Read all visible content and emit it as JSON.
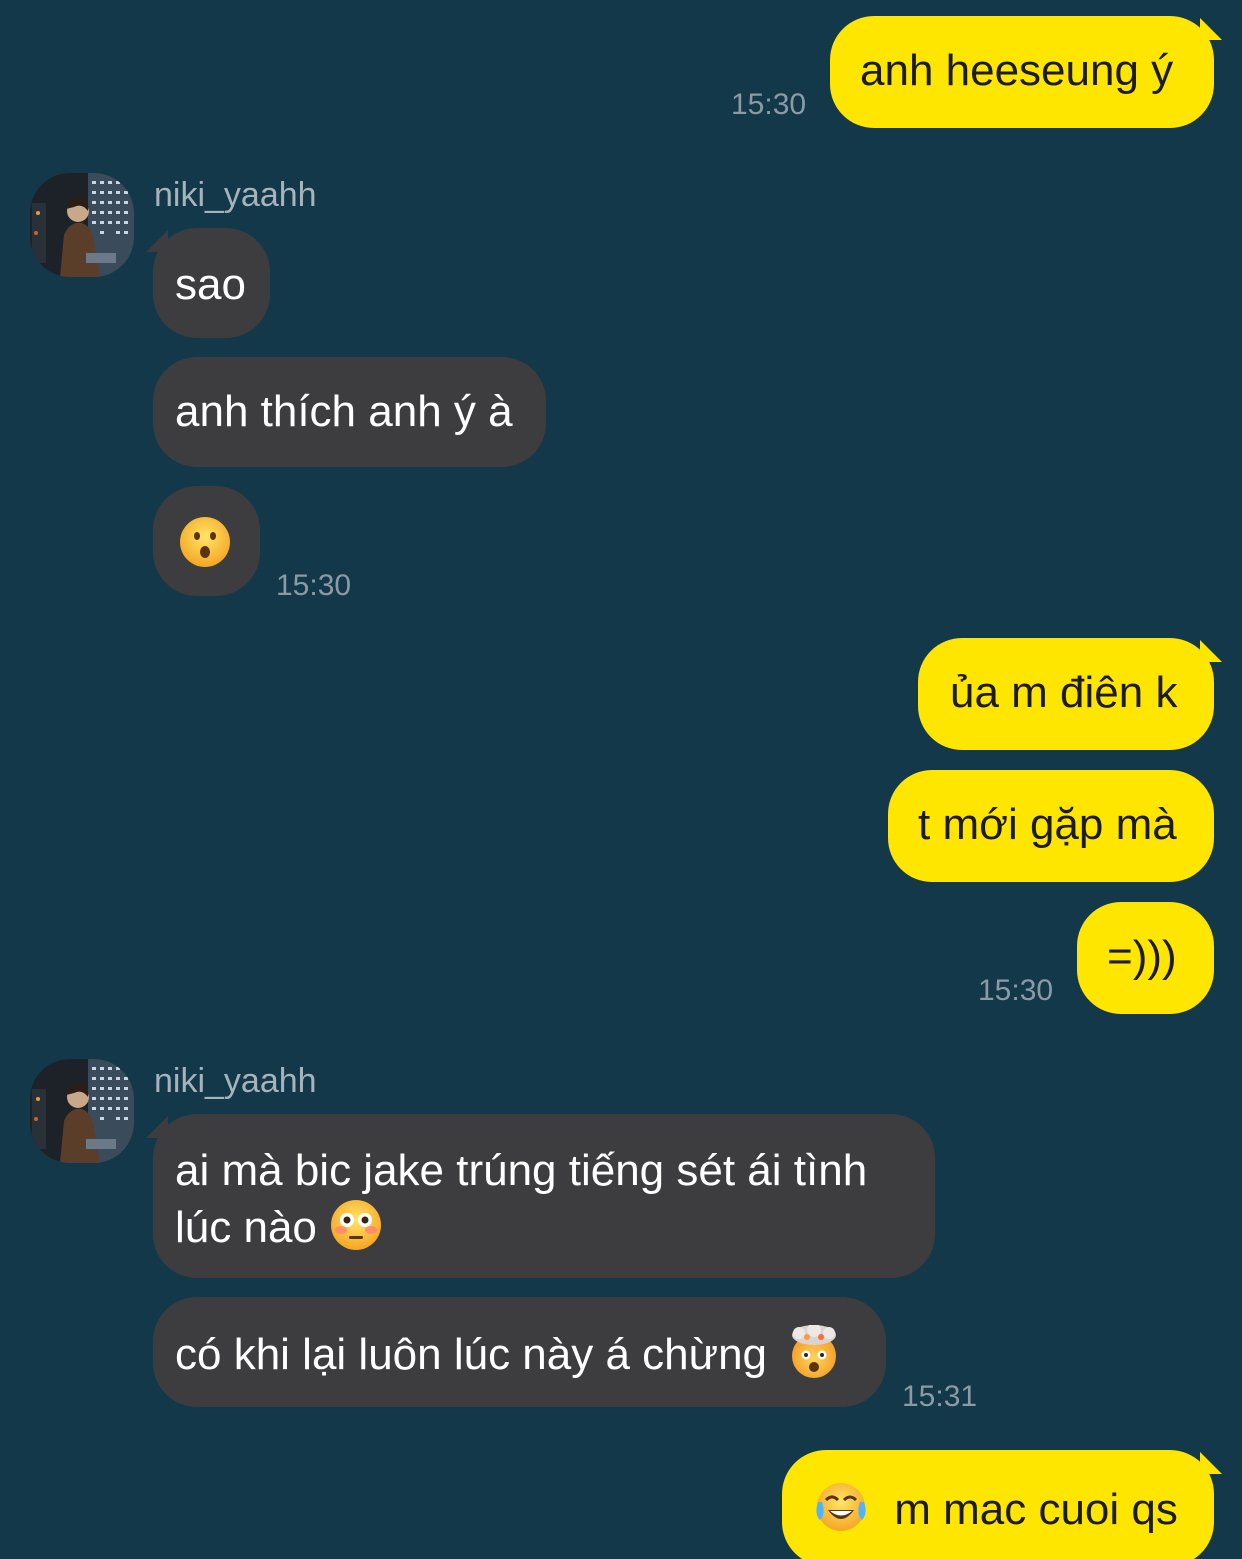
{
  "app": {
    "background_color": "#13384a",
    "outgoing_bubble_color": "#ffe600",
    "incoming_bubble_color": "#3d3d3f"
  },
  "messages": {
    "m1": {
      "text": "anh heeseung ý",
      "time": "15:30"
    },
    "sender1": {
      "name": "niki_yaahh"
    },
    "m2": {
      "text": "sao"
    },
    "m3": {
      "text": "anh thích anh ý à"
    },
    "m4": {
      "emoji": "hushed-face",
      "time": "15:30"
    },
    "m5": {
      "text": "ủa m điên k"
    },
    "m6": {
      "text": "t mới gặp mà"
    },
    "m7": {
      "text": "=)))",
      "time": "15:30"
    },
    "sender2": {
      "name": "niki_yaahh"
    },
    "m8": {
      "line1": "ai mà bic jake trúng tiếng sét ái tình",
      "line2": "lúc nào",
      "emoji": "flushed-face"
    },
    "m9": {
      "text": "có khi lại luôn lúc này á chừng",
      "emoji": "exploding-head",
      "time": "15:31"
    },
    "m10": {
      "emoji": "tears-of-joy",
      "text": "m mac cuoi qs"
    }
  }
}
